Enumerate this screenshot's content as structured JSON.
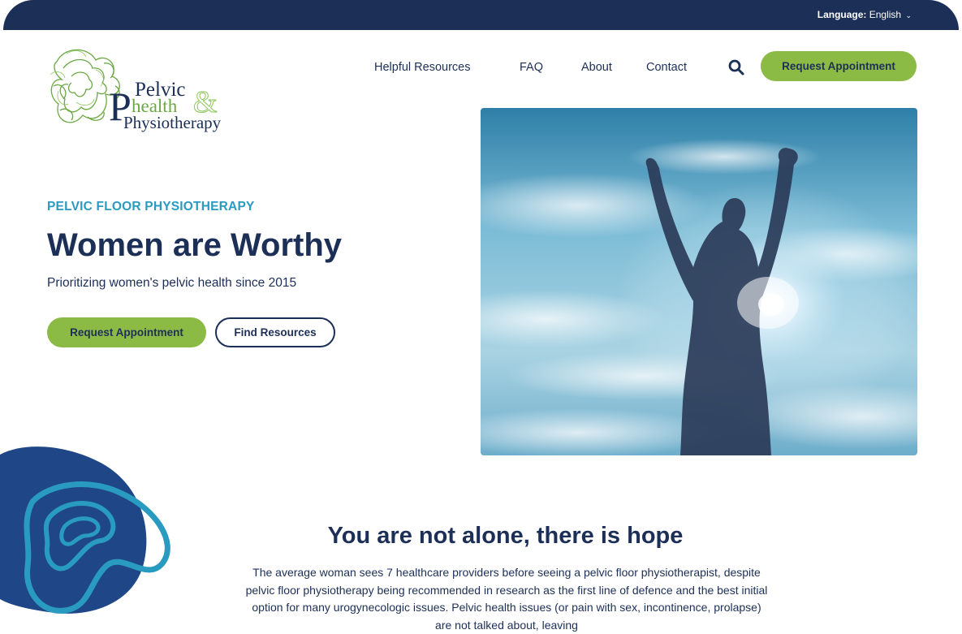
{
  "topbar": {
    "language_label": "Language:",
    "language_value": "English"
  },
  "logo": {
    "line1": "Pelvic",
    "line2": "health",
    "line3": "Physiotherapy",
    "ampersand": "&"
  },
  "nav": {
    "items": [
      {
        "label": "Helpful Resources"
      },
      {
        "label": "FAQ"
      },
      {
        "label": "About"
      },
      {
        "label": "Contact"
      }
    ],
    "cta_label": "Request Appointment"
  },
  "hero": {
    "eyebrow": "PELVIC FLOOR PHYSIOTHERAPY",
    "title": "Women are Worthy",
    "subtitle": "Prioritizing women's pelvic health since 2015",
    "primary_button": "Request Appointment",
    "secondary_button": "Find Resources"
  },
  "section": {
    "title": "You are not alone, there is hope",
    "paragraph": "The average woman sees 7 healthcare providers before seeing a pelvic floor physiotherapist, despite pelvic floor physiotherapy being recommended in research as the first line of defence and the best initial option for many urogynecologic issues. Pelvic health issues (or pain with sex, incontinence, prolapse) are not talked about, leaving"
  },
  "colors": {
    "navy": "#1c2f57",
    "green": "#8cbb45",
    "teal": "#2a9bc0",
    "blob_blue": "#1f4787"
  },
  "icons": {
    "search": "search-icon",
    "chevron": "chevron-down-icon"
  }
}
